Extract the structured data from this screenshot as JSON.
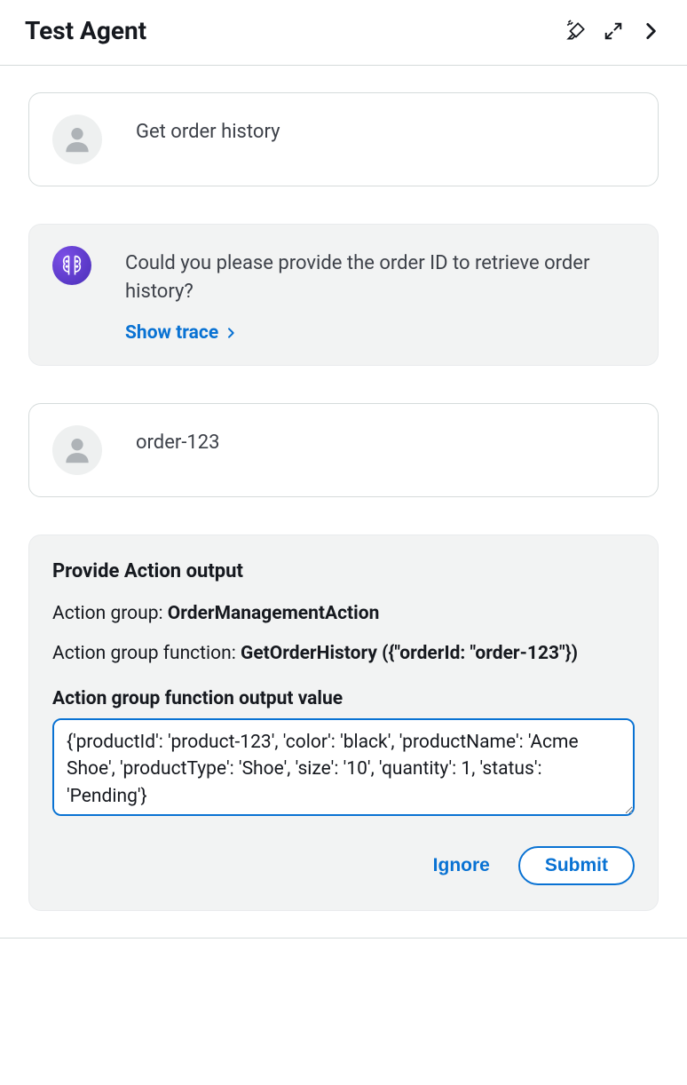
{
  "header": {
    "title": "Test Agent"
  },
  "messages": {
    "user1": "Get order history",
    "agent1": "Could you please provide the order ID to retrieve order history?",
    "show_trace": "Show trace",
    "user2": "order-123"
  },
  "action": {
    "heading": "Provide Action output",
    "group_label": "Action group: ",
    "group_value": "OrderManagementAction",
    "func_label": "Action group function: ",
    "func_value": "GetOrderHistory ({\"orderId: \"order-123\"})",
    "output_label": "Action group function output value",
    "output_value": "{'productId': 'product-123', 'color': 'black', 'productName': 'Acme Shoe', 'productType': 'Shoe', 'size': '10', 'quantity': 1, 'status': 'Pending'}",
    "ignore": "Ignore",
    "submit": "Submit"
  }
}
